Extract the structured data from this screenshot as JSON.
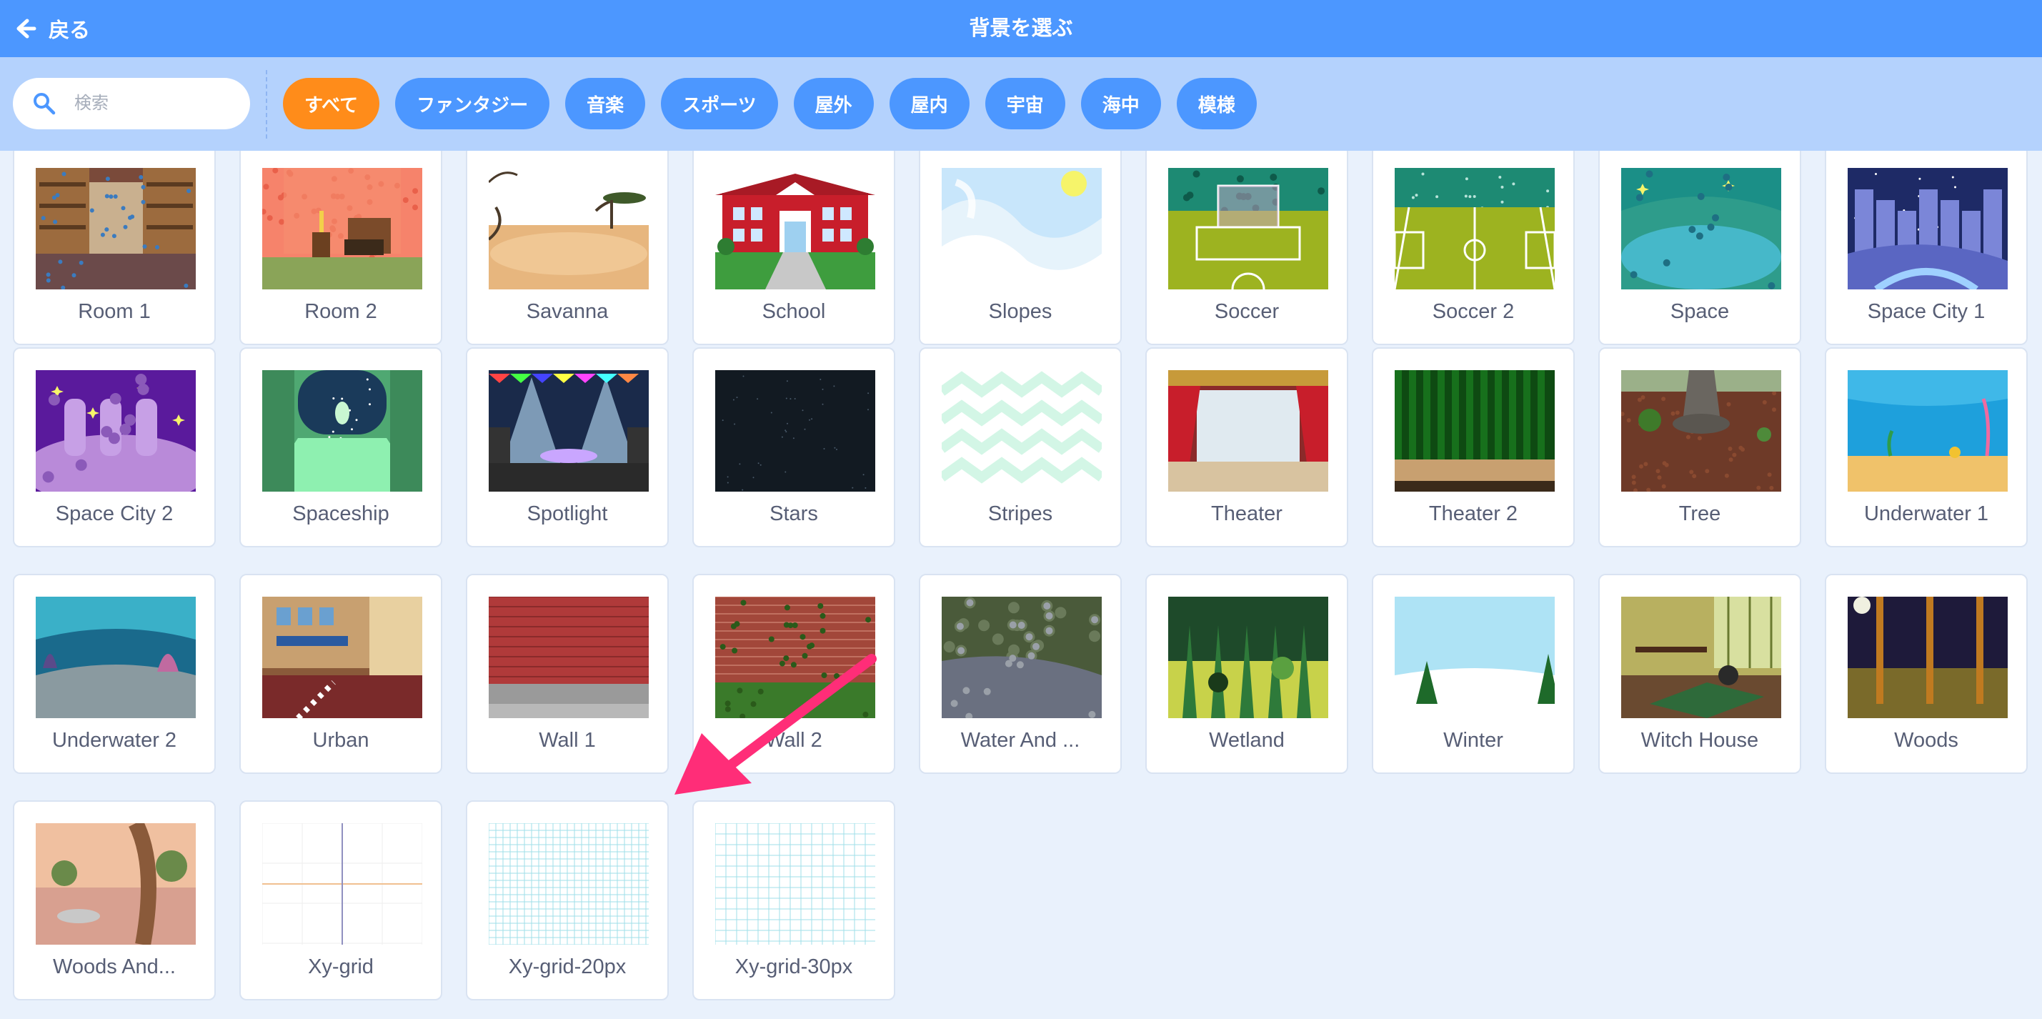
{
  "header": {
    "back_label": "戻る",
    "title": "背景を選ぶ"
  },
  "search": {
    "placeholder": "検索",
    "value": ""
  },
  "tags": [
    {
      "label": "すべて",
      "active": true
    },
    {
      "label": "ファンタジー",
      "active": false
    },
    {
      "label": "音楽",
      "active": false
    },
    {
      "label": "スポーツ",
      "active": false
    },
    {
      "label": "屋外",
      "active": false
    },
    {
      "label": "屋内",
      "active": false
    },
    {
      "label": "宇宙",
      "active": false
    },
    {
      "label": "海中",
      "active": false
    },
    {
      "label": "模様",
      "active": false
    }
  ],
  "backdrops": [
    {
      "name": "Room 1",
      "scene": "room1"
    },
    {
      "name": "Room 2",
      "scene": "room2"
    },
    {
      "name": "Savanna",
      "scene": "savanna"
    },
    {
      "name": "School",
      "scene": "school"
    },
    {
      "name": "Slopes",
      "scene": "slopes"
    },
    {
      "name": "Soccer",
      "scene": "soccer"
    },
    {
      "name": "Soccer 2",
      "scene": "soccer2"
    },
    {
      "name": "Space",
      "scene": "space"
    },
    {
      "name": "Space City 1",
      "scene": "spacecity1"
    },
    {
      "name": "Space City 2",
      "scene": "spacecity2"
    },
    {
      "name": "Spaceship",
      "scene": "spaceship"
    },
    {
      "name": "Spotlight",
      "scene": "spotlight"
    },
    {
      "name": "Stars",
      "scene": "stars"
    },
    {
      "name": "Stripes",
      "scene": "stripes"
    },
    {
      "name": "Theater",
      "scene": "theater"
    },
    {
      "name": "Theater 2",
      "scene": "theater2"
    },
    {
      "name": "Tree",
      "scene": "tree"
    },
    {
      "name": "Underwater 1",
      "scene": "underwater1"
    },
    {
      "name": "Underwater 2",
      "scene": "underwater2"
    },
    {
      "name": "Urban",
      "scene": "urban"
    },
    {
      "name": "Wall 1",
      "scene": "wall1"
    },
    {
      "name": "Wall 2",
      "scene": "wall2"
    },
    {
      "name": "Water And ...",
      "scene": "water"
    },
    {
      "name": "Wetland",
      "scene": "wetland"
    },
    {
      "name": "Winter",
      "scene": "winter"
    },
    {
      "name": "Witch House",
      "scene": "witch"
    },
    {
      "name": "Woods",
      "scene": "woods"
    },
    {
      "name": "Woods And...",
      "scene": "woodsand"
    },
    {
      "name": "Xy-grid",
      "scene": "xygrid"
    },
    {
      "name": "Xy-grid-20px",
      "scene": "grid20"
    },
    {
      "name": "Xy-grid-30px",
      "scene": "grid30"
    }
  ],
  "colors": {
    "header": "#4c97ff",
    "filterbar": "#b4d2fd",
    "tag": "#4c97ff",
    "tag_active": "#ff8c1a",
    "annotation_arrow": "#ff2d78",
    "label_text": "#575e75"
  },
  "icons": {
    "back": "arrow-left-icon",
    "search": "search-icon"
  }
}
